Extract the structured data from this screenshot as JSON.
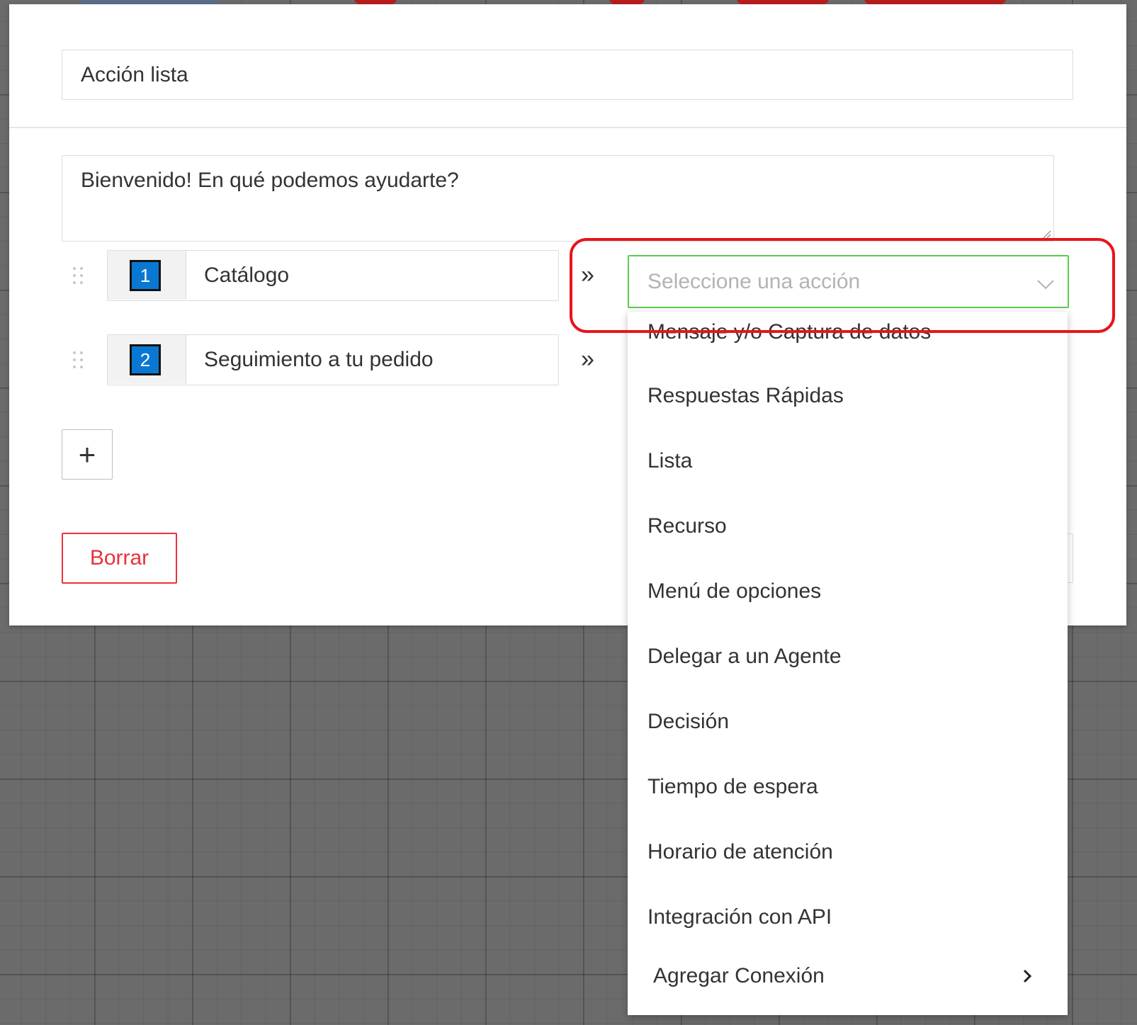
{
  "dialog": {
    "title_value": "Acción lista",
    "message_value": "Bienvenido! En qué podemos ayudarte?",
    "options": [
      {
        "number": "1",
        "label": "Catálogo"
      },
      {
        "number": "2",
        "label": "Seguimiento a tu pedido"
      }
    ],
    "arrow_glyph": "»",
    "add_label": "+",
    "delete_label": "Borrar",
    "action_select": {
      "placeholder": "Seleccione una acción"
    }
  },
  "dropdown": {
    "items": [
      "Mensaje y/o Captura de datos",
      "Respuestas Rápidas",
      "Lista",
      "Recurso",
      "Menú de opciones",
      "Delegar a un Agente",
      "Decisión",
      "Tiempo de espera",
      "Horario de atención",
      "Integración con API"
    ],
    "add_connection_label": "Agregar Conexión"
  },
  "colors": {
    "accent_blue": "#0a78d2",
    "select_border_green": "#5ccc4f",
    "danger_red": "#e8323a",
    "highlight_red": "#e8141c",
    "canvas_grey": "#6b6b6b"
  },
  "icons": {
    "drag": "drag-handle-icon",
    "arrow": "double-chevron-right-icon",
    "chevron": "chevron-down-icon",
    "submenu": "chevron-right-icon",
    "resize": "resize-grip-icon"
  }
}
